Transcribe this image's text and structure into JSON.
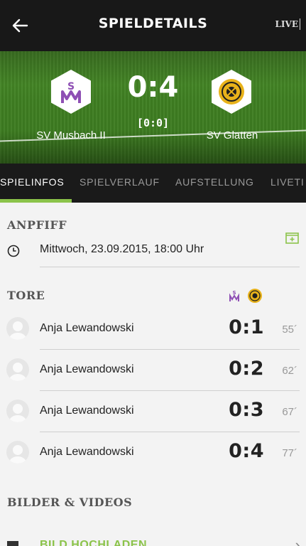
{
  "header": {
    "title": "SPIELDETAILS",
    "live_label": "LIVE"
  },
  "match": {
    "home_team": "SV Musbach II",
    "away_team": "SV Glatten",
    "score": "0:4",
    "halftime": "[0:0]"
  },
  "tabs": [
    {
      "label": "SPIELINFOS",
      "active": true
    },
    {
      "label": "SPIELVERLAUF",
      "active": false
    },
    {
      "label": "AUFSTELLUNG",
      "active": false
    },
    {
      "label": "LIVETI",
      "active": false
    }
  ],
  "kickoff": {
    "section_title": "ANPFIFF",
    "datetime": "Mittwoch, 23.09.2015, 18:00 Uhr"
  },
  "goals": {
    "section_title": "TORE",
    "items": [
      {
        "player": "Anja Lewandowski",
        "score": "0:1",
        "minute": "55´"
      },
      {
        "player": "Anja Lewandowski",
        "score": "0:2",
        "minute": "62´"
      },
      {
        "player": "Anja Lewandowski",
        "score": "0:3",
        "minute": "67´"
      },
      {
        "player": "Anja Lewandowski",
        "score": "0:4",
        "minute": "77´"
      }
    ]
  },
  "media": {
    "section_title": "BILDER & VIDEOS",
    "upload_label": "BILD HOCHLADEN"
  },
  "colors": {
    "accent": "#8bc34a",
    "header_bg": "#181818",
    "home_crest": "#8e4fb4",
    "away_crest": "#e8b21a"
  }
}
